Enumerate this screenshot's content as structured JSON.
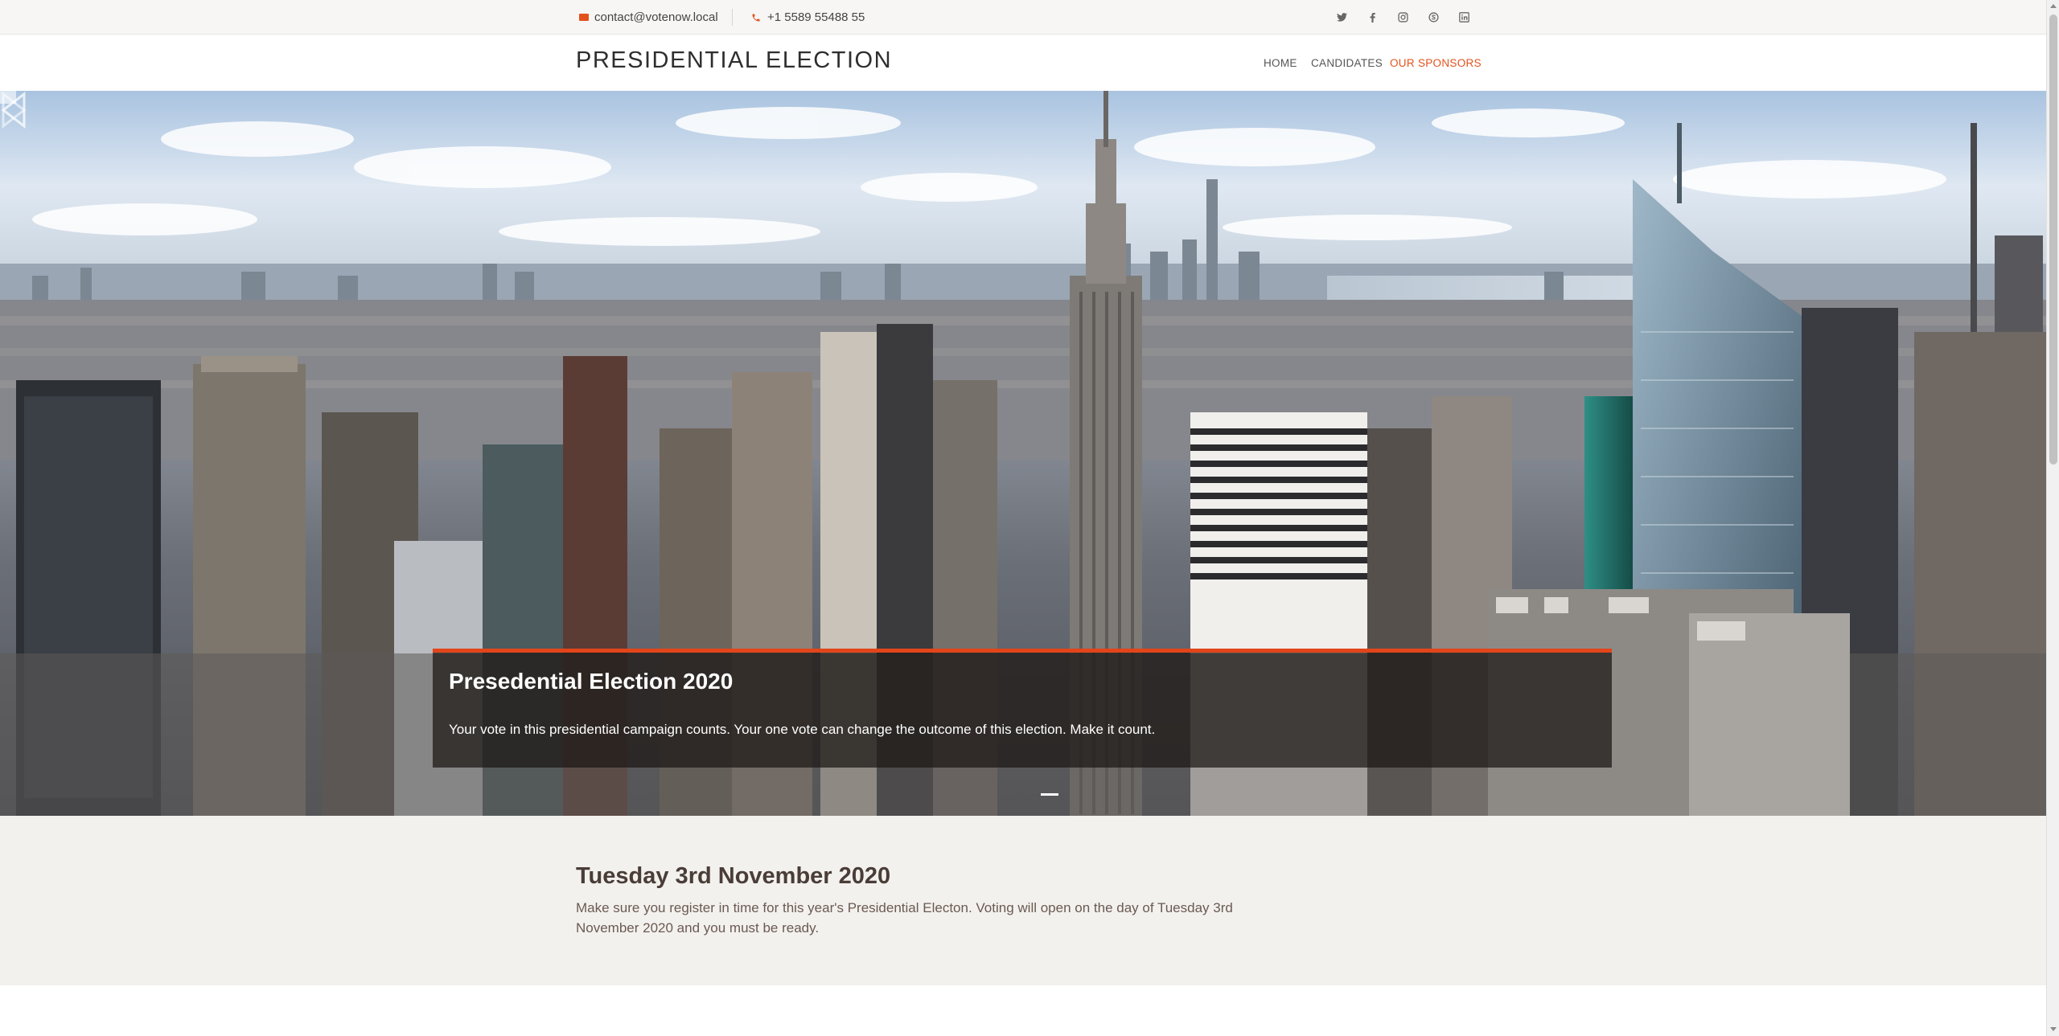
{
  "topbar": {
    "email": "contact@votenow.local",
    "phone": "+1 5589 55488 55",
    "social": [
      "twitter-icon",
      "facebook-icon",
      "instagram-icon",
      "skype-icon",
      "linkedin-icon"
    ]
  },
  "header": {
    "brand": "PRESIDENTIAL ELECTION",
    "nav": {
      "home": "HOME",
      "candidates": "CANDIDATES",
      "sponsors": "OUR SPONSORS"
    }
  },
  "hero": {
    "title": "Presedential Election 2020",
    "text": "Your vote in this presidential campaign counts. Your one vote can change the outcome of this election. Make it count."
  },
  "info": {
    "title": "Tuesday 3rd November 2020",
    "text": "Make sure you register in time for this year's Presidential Electon. Voting will open on the day of Tuesday 3rd November 2020 and you must be ready."
  },
  "colors": {
    "accent": "#e2521c",
    "brand_text": "#2e2e2e",
    "section_bg": "#f3f1ee"
  }
}
